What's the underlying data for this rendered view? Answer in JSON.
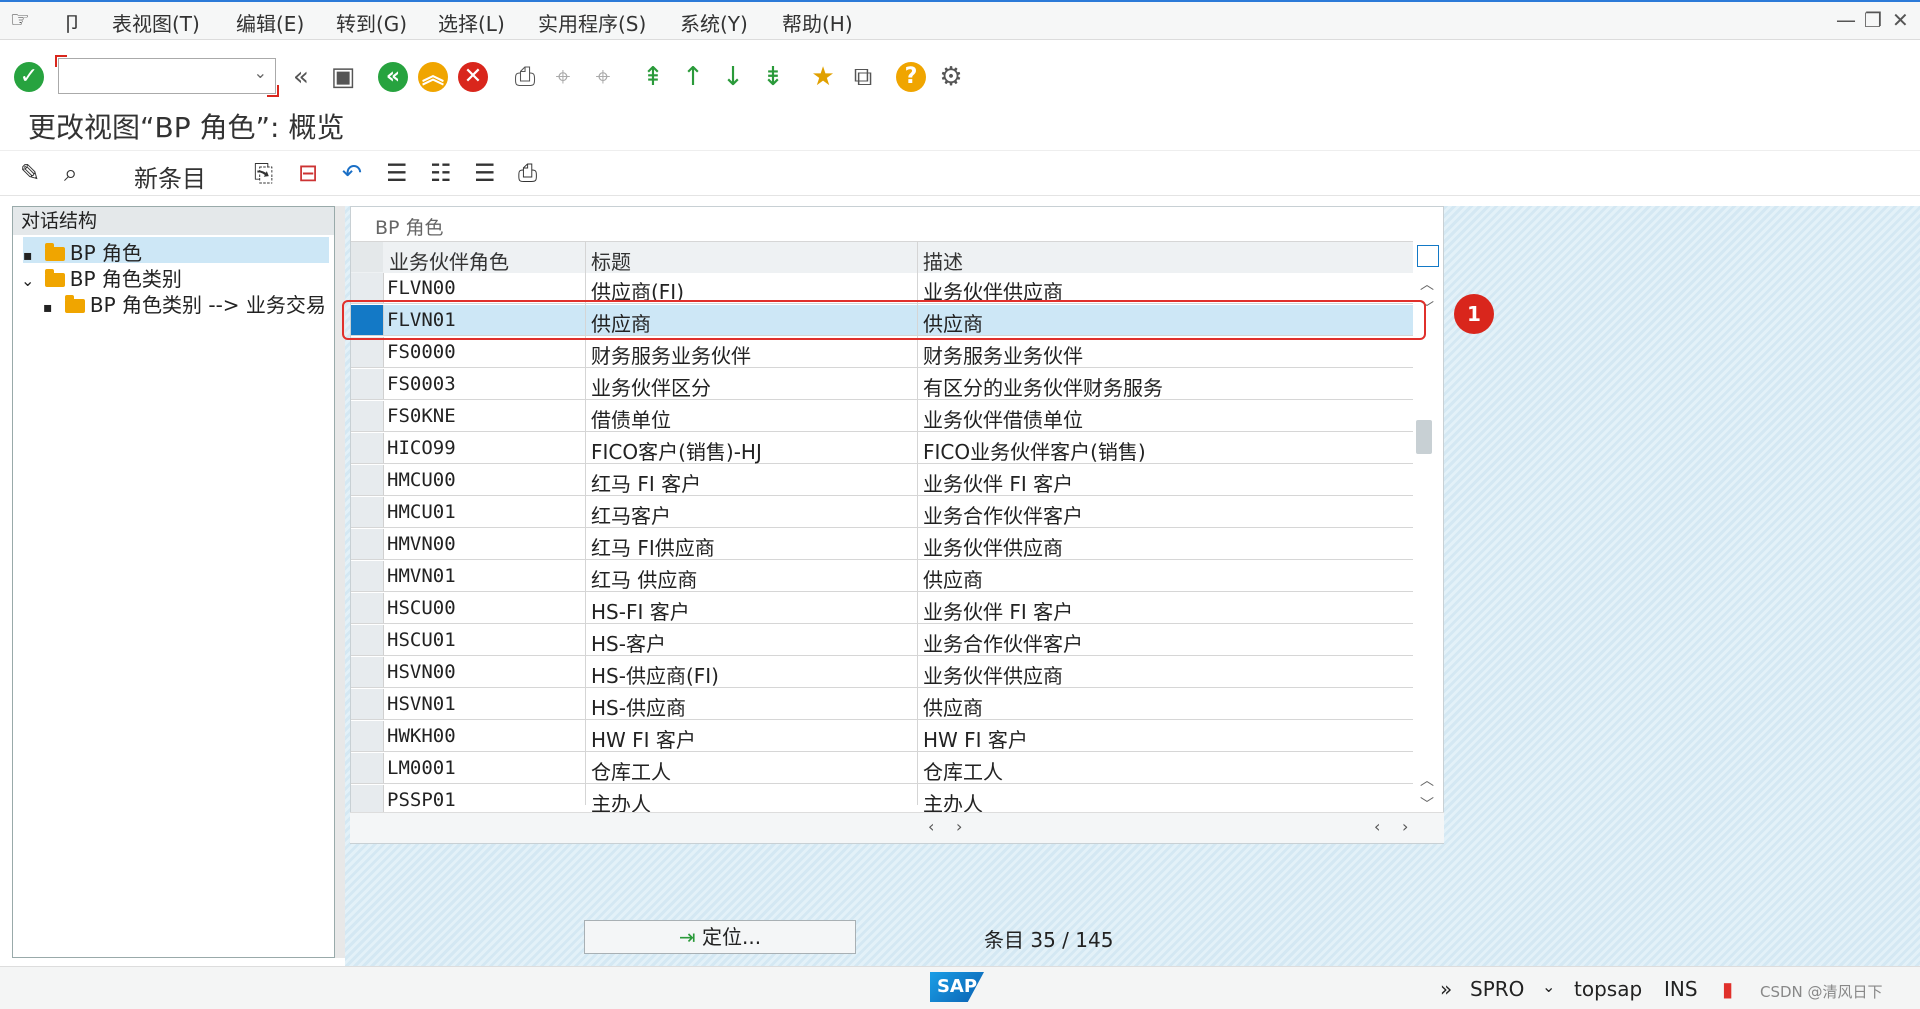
{
  "menubar": {
    "items": [
      "表视图(T)",
      "编辑(E)",
      "转到(G)",
      "选择(L)",
      "实用程序(S)",
      "系统(Y)",
      "帮助(H)"
    ]
  },
  "toolbar": {
    "command_value": ""
  },
  "page": {
    "title": "更改视图“BP 角色”: 概览"
  },
  "app_toolbar": {
    "new_entries_label": "新条目"
  },
  "tree": {
    "header": "对话结构",
    "items": [
      {
        "label": "BP 角色",
        "selected": true
      },
      {
        "label": "BP 角色类别"
      },
      {
        "label": "BP 角色类别 --> 业务交易"
      }
    ]
  },
  "table": {
    "title": "BP 角色",
    "columns": [
      "业务伙伴角色",
      "标题",
      "描述"
    ],
    "rows": [
      [
        "FLVN00",
        "供应商(FI)",
        "业务伙伴供应商"
      ],
      [
        "FLVN01",
        "供应商",
        "供应商"
      ],
      [
        "FS0000",
        "财务服务业务伙伴",
        "财务服务业务伙伴"
      ],
      [
        "FS0003",
        "业务伙伴区分",
        "有区分的业务伙伴财务服务"
      ],
      [
        "FS0KNE",
        "借债单位",
        "业务伙伴借债单位"
      ],
      [
        "HICO99",
        "FICO客户(销售)-HJ",
        "FICO业务伙伴客户(销售)"
      ],
      [
        "HMCU00",
        "红马 FI 客户",
        "业务伙伴 FI 客户"
      ],
      [
        "HMCU01",
        "红马客户",
        "业务合作伙伴客户"
      ],
      [
        "HMVN00",
        "红马 FI供应商",
        "业务伙伴供应商"
      ],
      [
        "HMVN01",
        "红马 供应商",
        "供应商"
      ],
      [
        "HSCU00",
        "HS-FI 客户",
        "业务伙伴 FI 客户"
      ],
      [
        "HSCU01",
        "HS-客户",
        "业务合作伙伴客户"
      ],
      [
        "HSVN00",
        "HS-供应商(FI)",
        "业务伙伴供应商"
      ],
      [
        "HSVN01",
        "HS-供应商",
        "供应商"
      ],
      [
        "HWKH00",
        "HW FI 客户",
        "HW FI 客户"
      ],
      [
        "LM0001",
        "仓库工人",
        "仓库工人"
      ],
      [
        "PSSP01",
        "主办人",
        "主办人"
      ]
    ],
    "selected_row_index": 1
  },
  "annotation": {
    "badge": "1"
  },
  "footer": {
    "locate_label": "定位...",
    "entry_label": "条目",
    "entry_count": "35 / 145"
  },
  "statusbar": {
    "transaction": "SPRO",
    "server": "topsap",
    "mode": "INS",
    "logo": "SAP",
    "watermark": "CSDN @清风日下"
  },
  "colors": {
    "selected_row": "#cde7f6",
    "row_marker": "#1379c6",
    "highlight": "#e0302b",
    "accent_blue": "#2b7ad8"
  }
}
